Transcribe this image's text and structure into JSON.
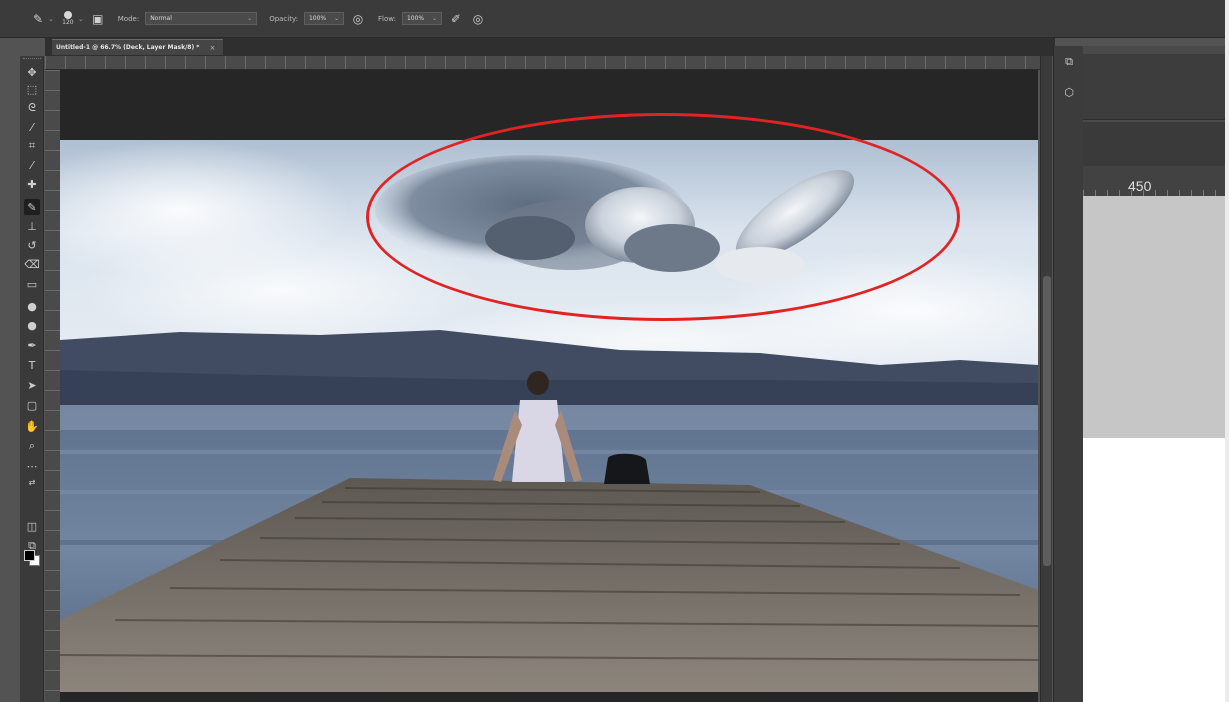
{
  "options_bar": {
    "brush_size": "120",
    "mode_label": "Mode:",
    "mode_value": "Normal",
    "opacity_label": "Opacity:",
    "opacity_value": "100%",
    "flow_label": "Flow:",
    "flow_value": "100%"
  },
  "document_tab": {
    "title": "Untitled-1 @ 66.7% (Deck, Layer Mask/8) *",
    "close_glyph": "×"
  },
  "dock": {
    "ruler_label": "450"
  },
  "colors": {
    "annotation": "#e02424",
    "foreground_swatch": "#000000",
    "background_swatch": "#ffffff"
  },
  "icons": {
    "tool_preset": "brush-icon",
    "brush_panel": "brush-settings-icon",
    "pressure_opacity": "pressure-opacity-icon",
    "airbrush": "airbrush-icon",
    "pressure_size": "pressure-size-icon"
  }
}
